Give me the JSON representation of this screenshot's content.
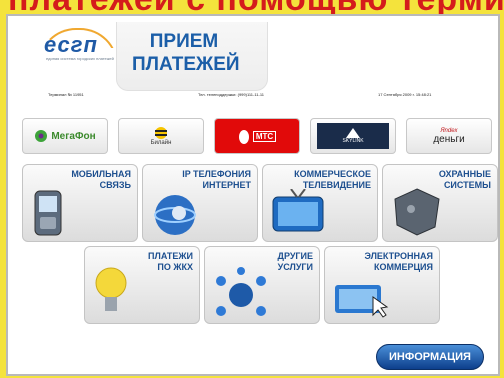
{
  "header": {
    "banner_text": "платежей с помощью терминалов",
    "logo_text": "есгп",
    "logo_sub": "единая система городских платежей",
    "title_line1": "ПРИЕМ",
    "title_line2": "ПЛАТЕЖЕЙ"
  },
  "infobar": {
    "terminal": "Терминал № 11951",
    "hotline": "Тел. телеподдержки: (999)111-11-11",
    "datetime": "17 Сентября 2009 г. 15:48:21"
  },
  "operators": [
    {
      "label": "МегаФон"
    },
    {
      "label": "Билайн"
    },
    {
      "label": "МТС"
    },
    {
      "label": "SKYLINK"
    },
    {
      "label": "деньги"
    }
  ],
  "categories": [
    {
      "label": "МОБИЛЬНАЯ\nСВЯЗЬ"
    },
    {
      "label": "IP ТЕЛЕФОНИЯ\nИНТЕРНЕТ"
    },
    {
      "label": "КОММЕРЧЕСКОЕ\nТЕЛЕВИДЕНИЕ"
    },
    {
      "label": "ОХРАННЫЕ\nСИСТЕМЫ"
    },
    {
      "label": "ПЛАТЕЖИ\nПО ЖКХ"
    },
    {
      "label": "ДРУГИЕ\nУСЛУГИ"
    },
    {
      "label": "ЭЛЕКТРОННАЯ\nКОММЕРЦИЯ"
    }
  ],
  "info_button": "ИНФОРМАЦИЯ",
  "colors": {
    "accent": "#1b5ea8",
    "banner": "#f4e33c",
    "banner_text": "#d41c1c"
  }
}
